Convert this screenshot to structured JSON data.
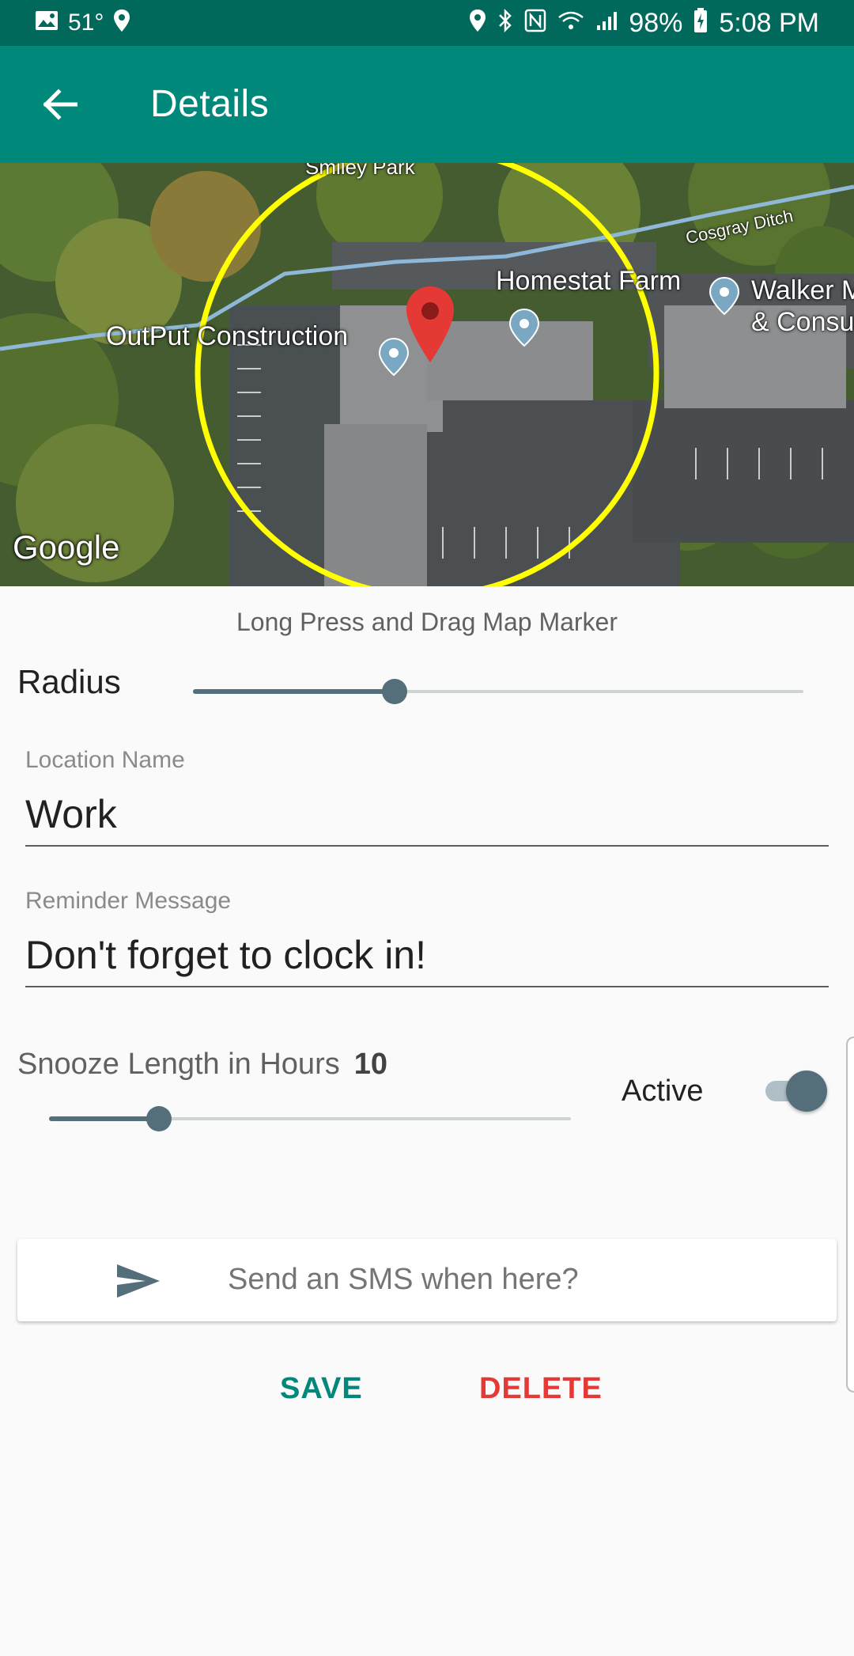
{
  "status_bar": {
    "temperature": "51°",
    "battery": "98%",
    "time": "5:08 PM"
  },
  "app_bar": {
    "title": "Details"
  },
  "map": {
    "labels": {
      "park": "Smiley Park",
      "ditch": "Cosgray Ditch",
      "farm": "Homestat Farm",
      "construction": "OutPut Construction",
      "walker_line1": "Walker M",
      "walker_line2": "& Consu"
    },
    "provider": "Google",
    "circle_color": "#ffff00",
    "marker_color": "#e53935"
  },
  "hint": "Long Press and Drag Map Marker",
  "radius": {
    "label": "Radius",
    "fraction": 0.33
  },
  "location_name": {
    "label": "Location Name",
    "value": "Work"
  },
  "reminder_message": {
    "label": "Reminder Message",
    "value": "Don't forget to clock in!"
  },
  "snooze": {
    "label": "Snooze Length in Hours",
    "value": "10",
    "fraction": 0.21
  },
  "active": {
    "label": "Active",
    "on": true
  },
  "sms": {
    "placeholder": "Send an SMS when here?"
  },
  "actions": {
    "save": "SAVE",
    "delete": "DELETE"
  },
  "colors": {
    "status_bar": "#00695c",
    "app_bar": "#00897b",
    "accent": "#546e7a",
    "save": "#00897b",
    "delete": "#e53935"
  }
}
